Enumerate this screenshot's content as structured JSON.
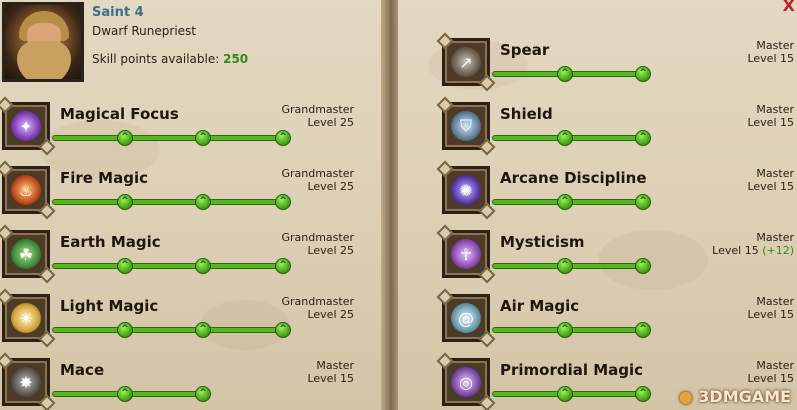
{
  "character": {
    "name": "Saint 4",
    "class": "Dwarf Runepriest",
    "skill_points_label": "Skill points available:",
    "skill_points_value": "250"
  },
  "left_skills": [
    {
      "name": "Magical Focus",
      "rank": "Grandmaster",
      "level": "Level 25",
      "icon": "magical-focus-icon",
      "color": "#7d3fb5"
    },
    {
      "name": "Fire Magic",
      "rank": "Grandmaster",
      "level": "Level 25",
      "icon": "fire-magic-icon",
      "color": "#c04a1c"
    },
    {
      "name": "Earth Magic",
      "rank": "Grandmaster",
      "level": "Level 25",
      "icon": "earth-magic-icon",
      "color": "#3f8a3a"
    },
    {
      "name": "Light Magic",
      "rank": "Grandmaster",
      "level": "Level 25",
      "icon": "light-magic-icon",
      "color": "#d2a43a"
    },
    {
      "name": "Mace",
      "rank": "Master",
      "level": "Level 15",
      "icon": "mace-icon",
      "color": "#5b5650"
    }
  ],
  "right_skills": [
    {
      "name": "Spear",
      "rank": "Master",
      "level": "Level 15",
      "icon": "spear-icon",
      "color": "#6b5f52"
    },
    {
      "name": "Shield",
      "rank": "Master",
      "level": "Level 15",
      "icon": "shield-icon",
      "color": "#5f7f99"
    },
    {
      "name": "Arcane Discipline",
      "rank": "Master",
      "level": "Level 15",
      "icon": "arcane-discipline-icon",
      "color": "#5a3aa8"
    },
    {
      "name": "Mysticism",
      "rank": "Master",
      "level": "Level 15",
      "bonus": "(+12)",
      "icon": "mysticism-icon",
      "color": "#8a4bb3"
    },
    {
      "name": "Air Magic",
      "rank": "Master",
      "level": "Level 15",
      "icon": "air-magic-icon",
      "color": "#6a99ad"
    },
    {
      "name": "Primordial Magic",
      "rank": "Master",
      "level": "Level 15",
      "icon": "primordial-magic-icon",
      "color": "#7a4aa6"
    }
  ],
  "watermark": "3DMGAME",
  "close_symbol": "X",
  "colors": {
    "accent_green": "#55b61f",
    "name_blue": "#3e6f8e",
    "bonus_green": "#2f8a1e"
  }
}
